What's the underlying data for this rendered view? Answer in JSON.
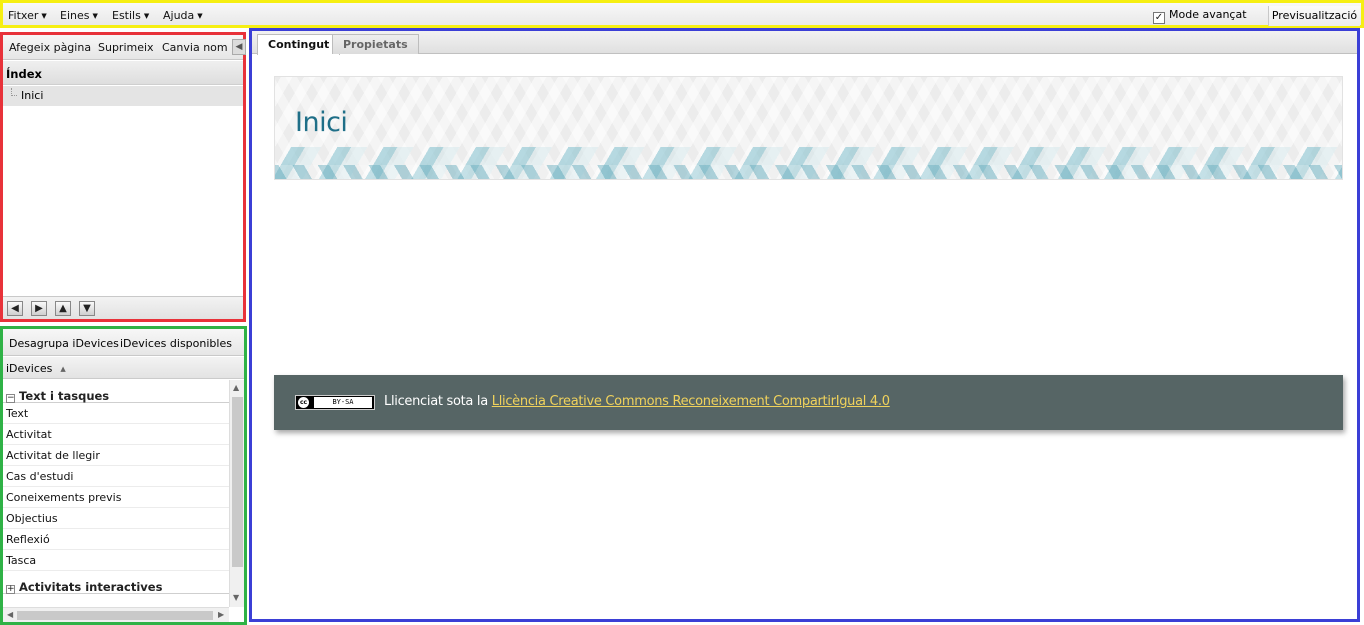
{
  "menubar": {
    "menus": [
      {
        "label": "Fitxer"
      },
      {
        "label": "Eines"
      },
      {
        "label": "Estils"
      },
      {
        "label": "Ajuda"
      }
    ],
    "advanced_mode_label": "Mode avançat",
    "advanced_mode_checked": true,
    "preview_label": "Previsualització"
  },
  "outline": {
    "toolbar": {
      "add_page": "Afegeix pàgina",
      "delete": "Suprimeix",
      "rename": "Canvia nom"
    },
    "header": "Índex",
    "nodes": [
      {
        "label": "Inici",
        "selected": true
      }
    ],
    "nav_icons": [
      "arrow-left-icon",
      "arrow-right-icon",
      "arrow-up-icon",
      "arrow-down-icon"
    ]
  },
  "idevices": {
    "toolbar": {
      "ungroup": "Desagrupa iDevices",
      "available": "iDevices disponibles"
    },
    "column_header": "iDevices",
    "groups": [
      {
        "label": "Text i tasques",
        "expanded": true,
        "items": [
          "Text",
          "Activitat",
          "Activitat de llegir",
          "Cas d'estudi",
          "Coneixements previs",
          "Objectius",
          "Reflexió",
          "Tasca"
        ]
      },
      {
        "label": "Activitats interactives",
        "expanded": false,
        "items": []
      }
    ]
  },
  "main": {
    "tabs": [
      {
        "label": "Contingut",
        "active": true
      },
      {
        "label": "Propietats",
        "active": false
      }
    ],
    "page_title": "Inici",
    "license": {
      "badge": "BY-SA",
      "badge_cc": "cc",
      "prefix": "Llicenciat sota la",
      "link_text": "Llicència Creative Commons Reconeixement CompartirIgual 4.0"
    }
  },
  "colors": {
    "menubar_outline": "#f6ef12",
    "outline_panel": "#e8323a",
    "idevices_panel": "#2fb246",
    "main_panel": "#3b3fd6",
    "title": "#1f6f88",
    "footer_bg": "#566565",
    "link": "#f0d25c"
  }
}
